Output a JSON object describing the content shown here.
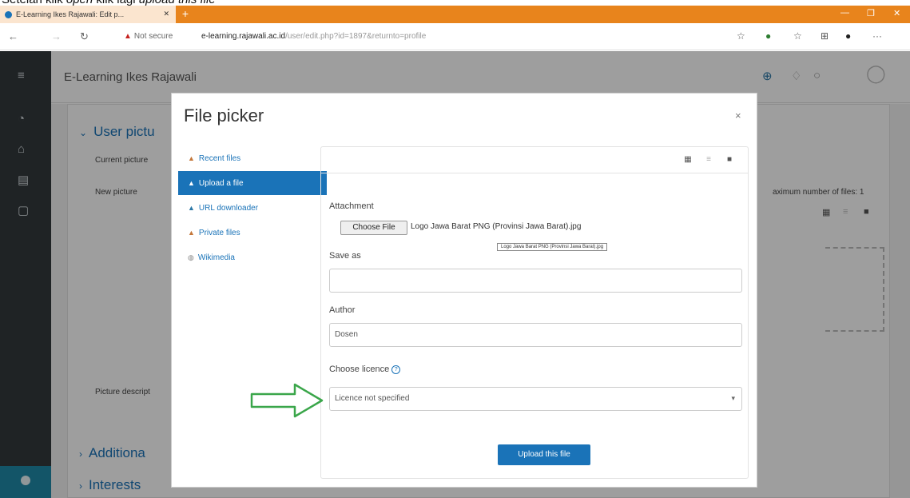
{
  "caption": {
    "prefix": "Setelah klik ",
    "em1": "open",
    "mid": " klik lagi ",
    "em2": "upload this file"
  },
  "browser": {
    "tab_title": "E-Learning Ikes Rajawali: Edit p...",
    "not_secure": "Not secure",
    "url_host": "e-learning.rajawali.ac.id",
    "url_path": "/user/edit.php?id=1897&returnto=profile"
  },
  "site": {
    "name": "E-Learning Ikes Rajawali"
  },
  "background": {
    "section_user_picture": "User pictu",
    "current_picture": "Current picture",
    "new_picture": "New picture",
    "picture_description": "Picture descript",
    "section_additional": "Additiona",
    "section_interests": "Interests",
    "max_files": "aximum number of files: 1"
  },
  "modal": {
    "title": "File picker",
    "close": "×",
    "sidebar": [
      {
        "label": "Recent files",
        "icon": "recent-files-icon"
      },
      {
        "label": "Upload a file",
        "icon": "upload-icon",
        "active": true
      },
      {
        "label": "URL downloader",
        "icon": "url-icon"
      },
      {
        "label": "Private files",
        "icon": "private-files-icon"
      },
      {
        "label": "Wikimedia",
        "icon": "wikimedia-icon"
      }
    ],
    "form": {
      "attachment_label": "Attachment",
      "choose_file_button": "Choose File",
      "chosen_file": "Logo Jawa Barat PNG (Provinsi Jawa Barat).jpg",
      "tooltip": "Logo Jawa Barat PNG (Provinsi Jawa Barat).jpg",
      "save_as_label": "Save as",
      "save_as_value": "",
      "author_label": "Author",
      "author_value": "Dosen",
      "licence_label": "Choose licence",
      "licence_value": "Licence not specified",
      "upload_button": "Upload this file"
    }
  },
  "colors": {
    "accent": "#1a73b8",
    "arrow": "#3aa64a",
    "tabbar": "#e8841c"
  }
}
